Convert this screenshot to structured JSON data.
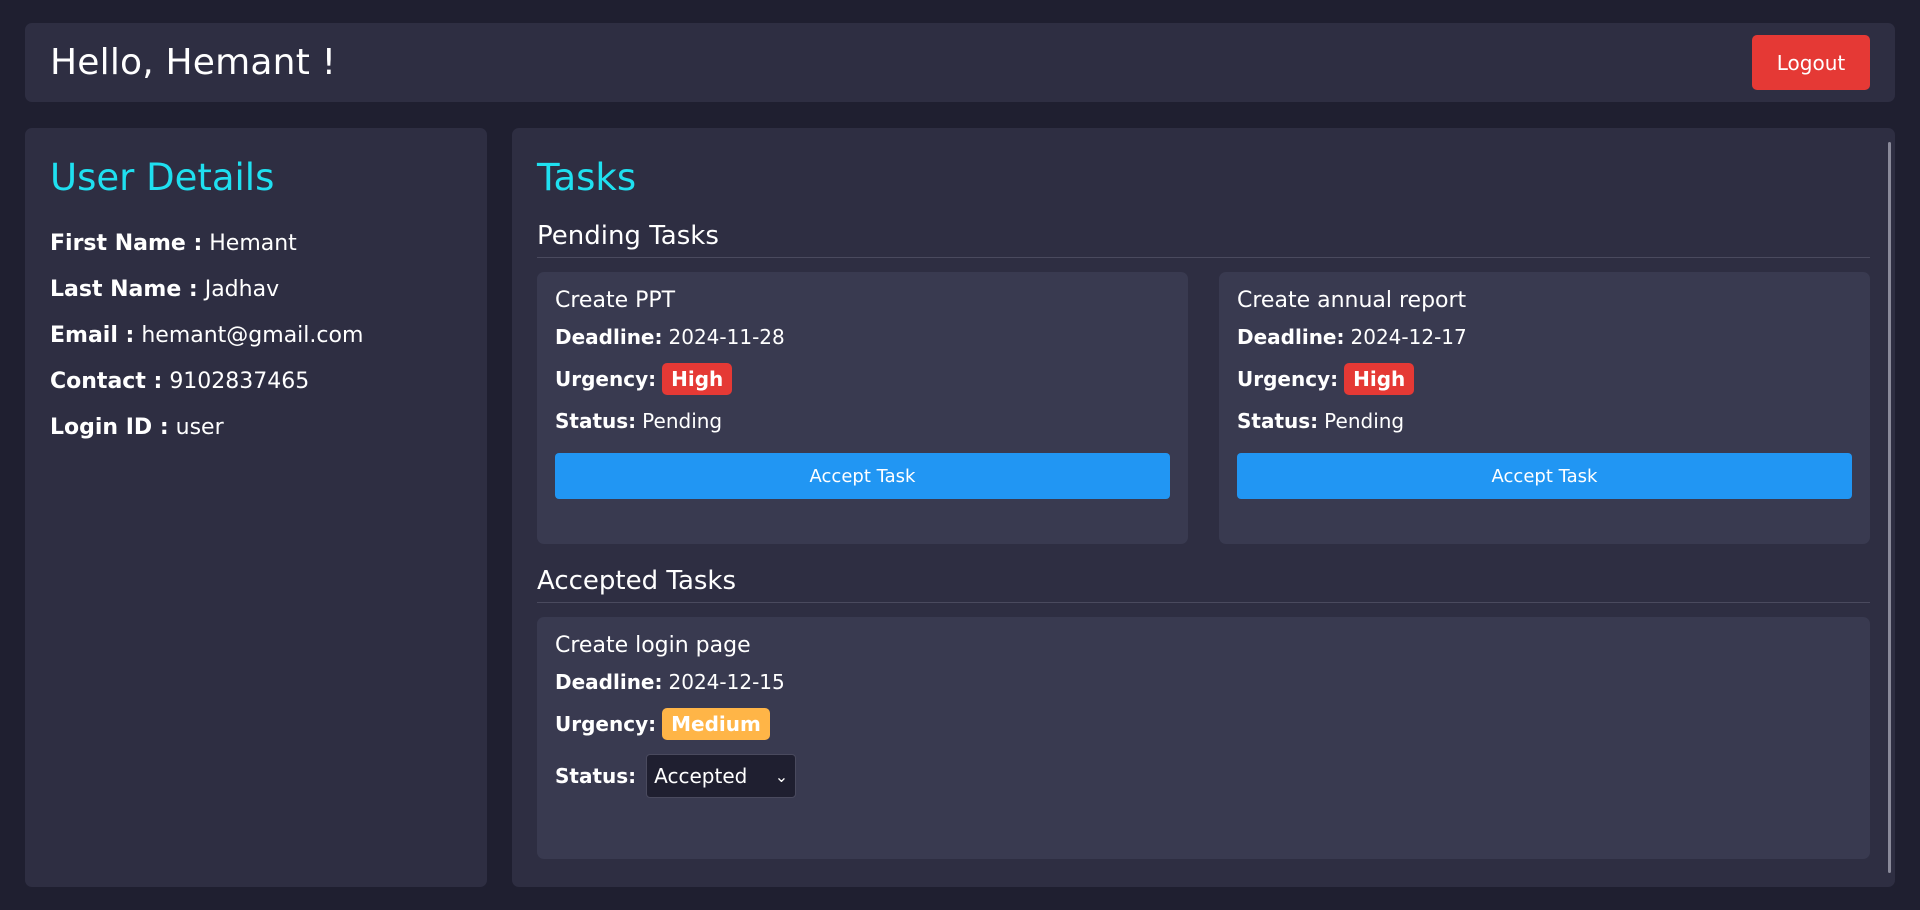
{
  "header": {
    "greeting": "Hello, Hemant !",
    "logout_label": "Logout"
  },
  "user_details": {
    "title": "User Details",
    "fields": [
      {
        "label": "First Name :",
        "value": "Hemant"
      },
      {
        "label": "Last Name :",
        "value": "Jadhav"
      },
      {
        "label": "Email :",
        "value": "hemant@gmail.com"
      },
      {
        "label": "Contact :",
        "value": "9102837465"
      },
      {
        "label": "Login ID :",
        "value": "user"
      }
    ]
  },
  "tasks": {
    "title": "Tasks",
    "pending_title": "Pending Tasks",
    "accepted_title": "Accepted Tasks",
    "labels": {
      "deadline": "Deadline:",
      "urgency": "Urgency:",
      "status": "Status:"
    },
    "pending": [
      {
        "name": "Create PPT",
        "deadline": "2024-11-28",
        "urgency": "High",
        "status": "Pending",
        "button": "Accept Task"
      },
      {
        "name": "Create annual report",
        "deadline": "2024-12-17",
        "urgency": "High",
        "status": "Pending",
        "button": "Accept Task"
      }
    ],
    "accepted": [
      {
        "name": "Create login page",
        "deadline": "2024-12-15",
        "urgency": "Medium",
        "status_selected": "Accepted"
      }
    ]
  },
  "colors": {
    "accent": "#1fe0f0",
    "danger": "#e53935",
    "primary": "#2196f3",
    "warning": "#ffb547"
  },
  "icons": {
    "select_caret": "chevron-down-icon"
  }
}
